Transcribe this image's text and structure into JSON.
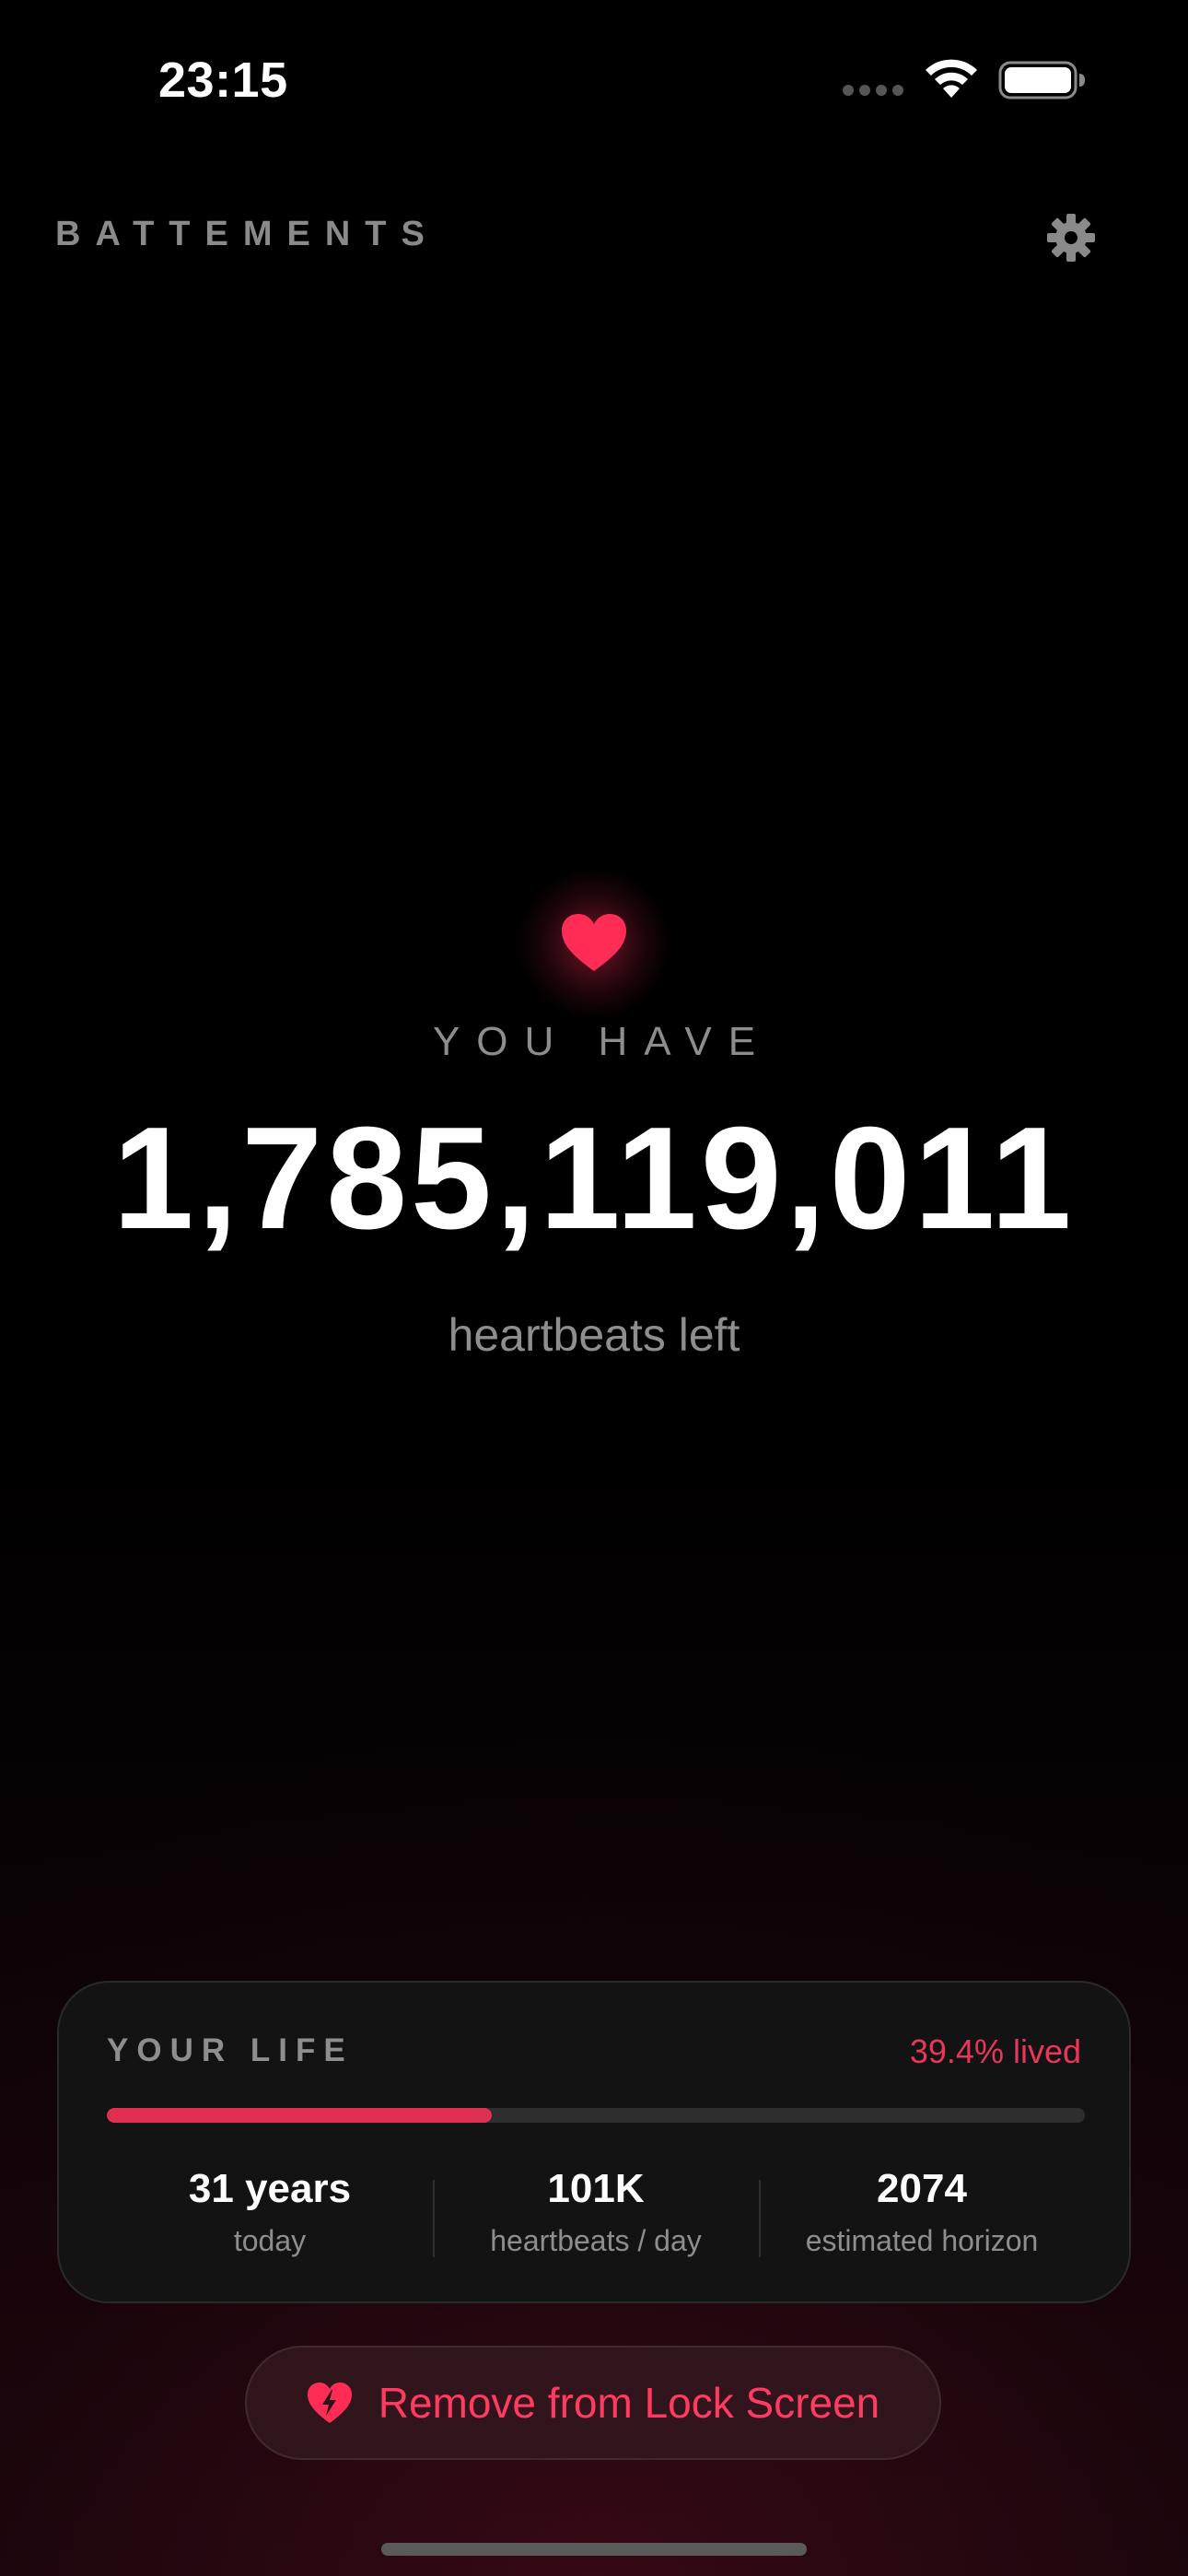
{
  "status_bar": {
    "time": "23:15",
    "icons": [
      "signal-dots-icon",
      "wifi-icon",
      "battery-icon"
    ]
  },
  "header": {
    "app_title": "BATTEMENTS",
    "settings_icon": "gear-icon"
  },
  "hero": {
    "icon": "heart-icon",
    "kicker": "YOU HAVE",
    "count": "1,785,119,011",
    "caption": "heartbeats left"
  },
  "life_card": {
    "title": "YOUR LIFE",
    "percent_lived": "39.4% lived",
    "progress_fraction": 0.394,
    "stats": [
      {
        "value": "31 years",
        "label": "today"
      },
      {
        "value": "101K",
        "label": "heartbeats / day"
      },
      {
        "value": "2074",
        "label": "estimated horizon"
      }
    ]
  },
  "lock_button": {
    "icon": "heart-bolt-icon",
    "label": "Remove from Lock Screen"
  },
  "colors": {
    "accent": "#ff2d55",
    "accent_text": "#ff3b62",
    "progress_fill": "#e0304f",
    "background": "#000000",
    "card_background": "#131313",
    "muted_text": "#8e8e8e"
  }
}
